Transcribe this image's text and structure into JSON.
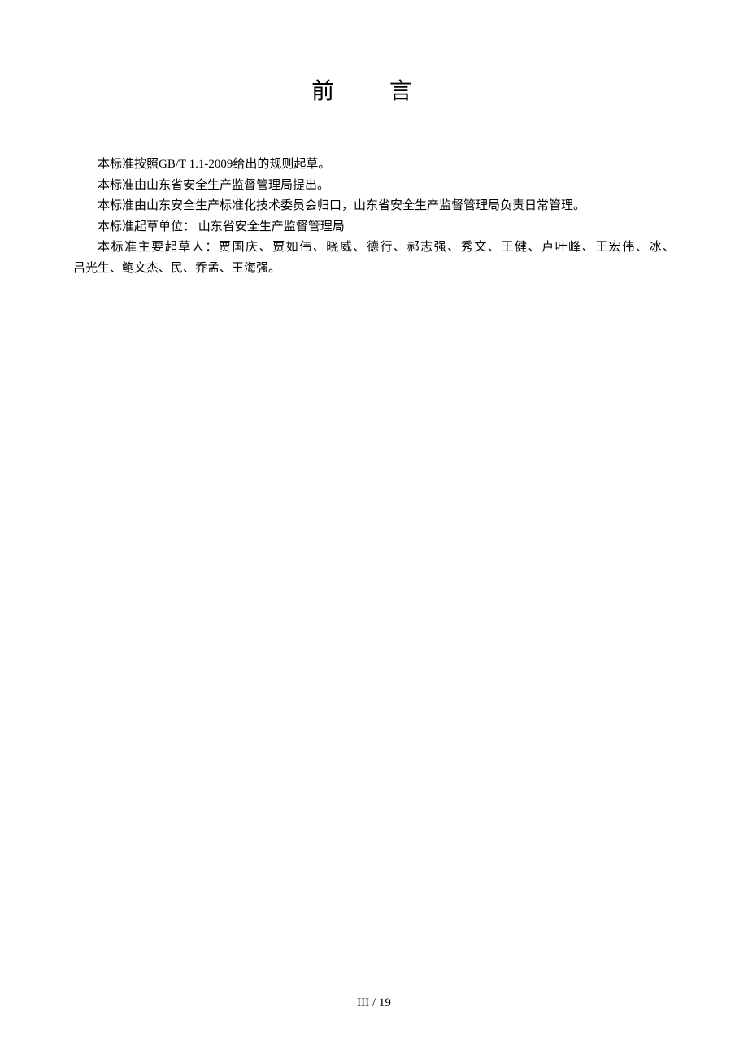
{
  "title": "前 言",
  "paragraphs": {
    "p1": "本标准按照GB/T 1.1-2009给出的规则起草。",
    "p2": "本标准由山东省安全生产监督管理局提出。",
    "p3": "本标准由山东安全生产标准化技术委员会归口，山东省安全生产监督管理局负责日常管理。",
    "p4": "本标准起草单位： 山东省安全生产监督管理局",
    "p5a": "本标准主要起草人：贾国庆、贾如伟、晓威、德行、郝志强、秀文、王健、卢叶峰、王宏伟、冰、",
    "p5b": "吕光生、鲍文杰、民、乔孟、王海强。"
  },
  "footer": {
    "page_roman": "III",
    "separator": " / ",
    "page_total": "19"
  }
}
